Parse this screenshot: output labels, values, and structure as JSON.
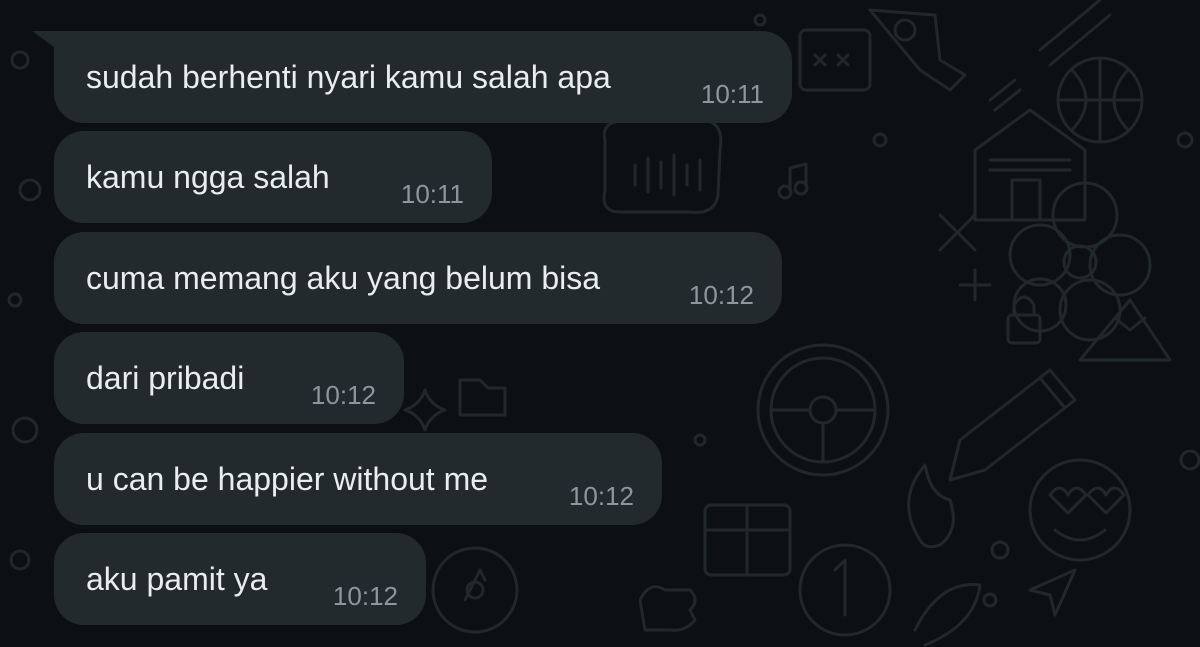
{
  "conversation": {
    "messages": [
      {
        "text": "sudah berhenti nyari kamu salah apa",
        "time": "10:11"
      },
      {
        "text": "kamu ngga salah",
        "time": "10:11"
      },
      {
        "text": "cuma memang aku yang belum bisa",
        "time": "10:12"
      },
      {
        "text": "dari pribadi",
        "time": "10:12"
      },
      {
        "text": "u can be happier without me",
        "time": "10:12"
      },
      {
        "text": "aku pamit ya",
        "time": "10:12"
      }
    ]
  },
  "theme": {
    "background": "#0c1012",
    "bubble": "#222a2e",
    "text": "#e9edef",
    "timestamp": "#8d979c",
    "doodle": "#21282c"
  }
}
